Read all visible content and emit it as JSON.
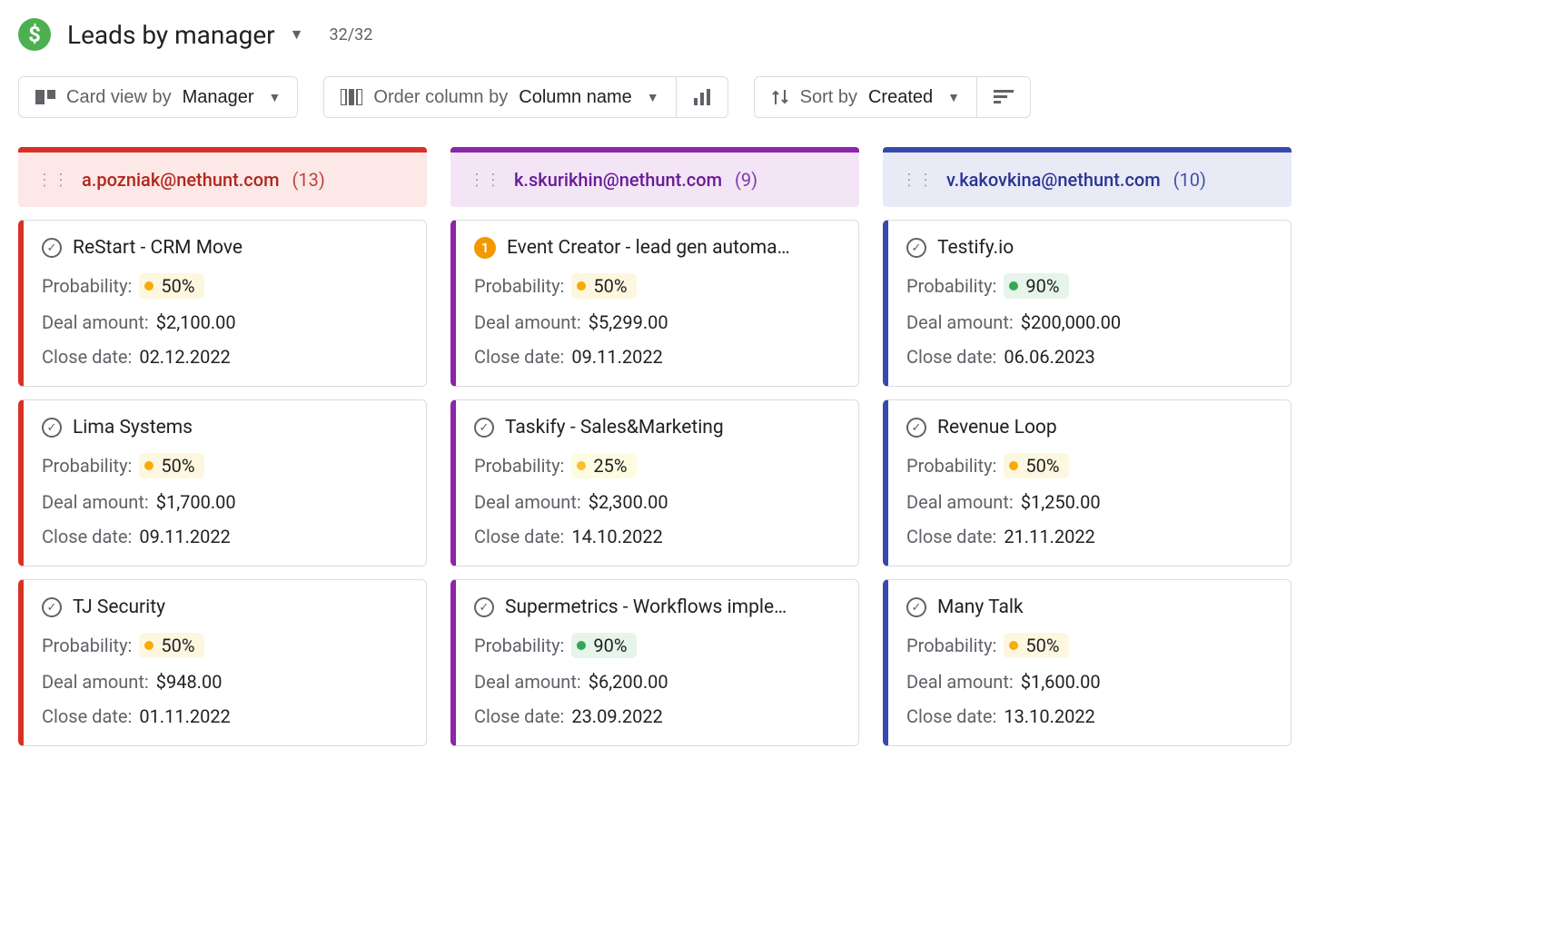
{
  "header": {
    "title": "Leads by manager",
    "count": "32/32"
  },
  "toolbar": {
    "view": {
      "prefix": "Card view by",
      "value": "Manager"
    },
    "order": {
      "prefix": "Order column by",
      "value": "Column name"
    },
    "sort": {
      "prefix": "Sort by",
      "value": "Created"
    }
  },
  "labels": {
    "probability": "Probability:",
    "deal_amount": "Deal amount:",
    "close_date": "Close date:"
  },
  "columns": [
    {
      "color": "red",
      "email": "a.pozniak@nethunt.com",
      "count": "(13)",
      "cards": [
        {
          "icon": "check",
          "title": "ReStart - CRM Move",
          "prob_class": "p50",
          "probability": "50%",
          "amount": "$2,100.00",
          "close": "02.12.2022"
        },
        {
          "icon": "check",
          "title": "Lima Systems",
          "prob_class": "p50",
          "probability": "50%",
          "amount": "$1,700.00",
          "close": "09.11.2022"
        },
        {
          "icon": "check",
          "title": "TJ Security",
          "prob_class": "p50",
          "probability": "50%",
          "amount": "$948.00",
          "close": "01.11.2022"
        }
      ]
    },
    {
      "color": "purple",
      "email": "k.skurikhin@nethunt.com",
      "count": "(9)",
      "cards": [
        {
          "icon": "badge",
          "badge": "1",
          "title": "Event Creator - lead gen automa…",
          "prob_class": "p50",
          "probability": "50%",
          "amount": "$5,299.00",
          "close": "09.11.2022"
        },
        {
          "icon": "check",
          "title": "Taskify - Sales&Marketing",
          "prob_class": "p25",
          "probability": "25%",
          "amount": "$2,300.00",
          "close": "14.10.2022"
        },
        {
          "icon": "check",
          "title": "Supermetrics - Workflows imple…",
          "prob_class": "p90",
          "probability": "90%",
          "amount": "$6,200.00",
          "close": "23.09.2022"
        }
      ]
    },
    {
      "color": "blue",
      "email": "v.kakovkina@nethunt.com",
      "count": "(10)",
      "cards": [
        {
          "icon": "check",
          "title": "Testify.io",
          "prob_class": "p90",
          "probability": "90%",
          "amount": "$200,000.00",
          "close": "06.06.2023"
        },
        {
          "icon": "check",
          "title": "Revenue Loop",
          "prob_class": "p50",
          "probability": "50%",
          "amount": "$1,250.00",
          "close": "21.11.2022"
        },
        {
          "icon": "check",
          "title": "Many Talk",
          "prob_class": "p50",
          "probability": "50%",
          "amount": "$1,600.00",
          "close": "13.10.2022"
        }
      ]
    }
  ]
}
